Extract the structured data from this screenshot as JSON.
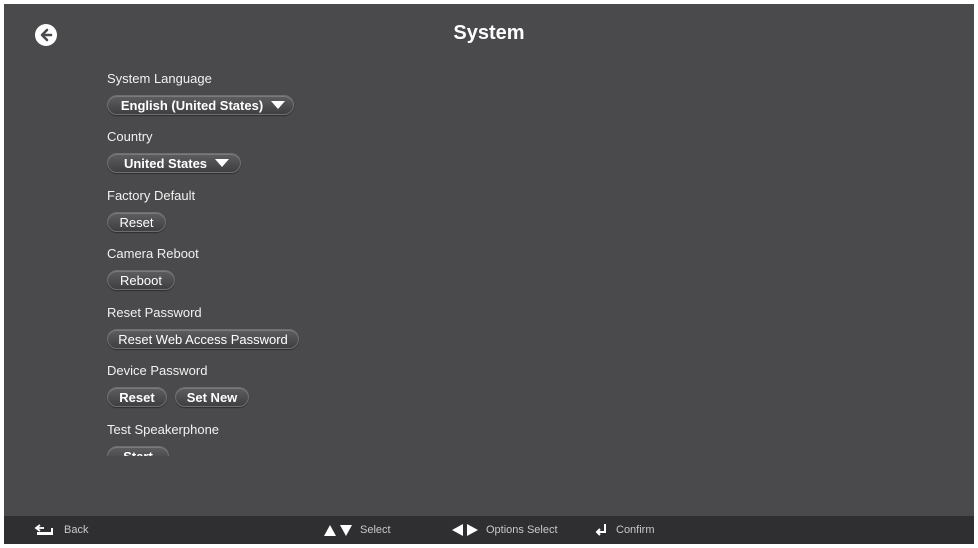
{
  "header": {
    "title": "System",
    "back_icon": "back-arrow-circle-icon"
  },
  "sections": {
    "language": {
      "label": "System Language",
      "value": "English (United States)"
    },
    "country": {
      "label": "Country",
      "value": "United States"
    },
    "factory": {
      "label": "Factory Default",
      "button": "Reset"
    },
    "camera": {
      "label": "Camera Reboot",
      "button": "Reboot"
    },
    "reset_password": {
      "label": "Reset Password",
      "button": "Reset Web Access Password"
    },
    "device_password": {
      "label": "Device Password",
      "reset": "Reset",
      "set_new": "Set New"
    },
    "speakerphone": {
      "label": "Test Speakerphone",
      "button": "Start"
    }
  },
  "footer": {
    "back": "Back",
    "select": "Select",
    "options_select": "Options Select",
    "confirm": "Confirm"
  },
  "colors": {
    "background": "#4a494b",
    "footer": "#2f2e30",
    "text": "#ffffff"
  }
}
